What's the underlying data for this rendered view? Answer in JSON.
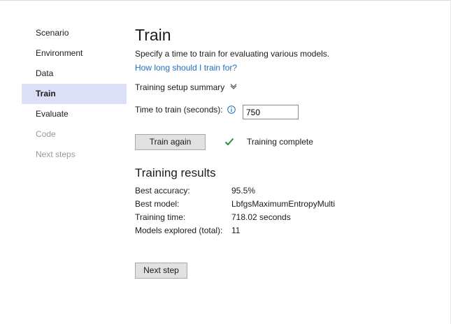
{
  "nav": [
    {
      "label": "Scenario",
      "state": "normal"
    },
    {
      "label": "Environment",
      "state": "normal"
    },
    {
      "label": "Data",
      "state": "normal"
    },
    {
      "label": "Train",
      "state": "selected"
    },
    {
      "label": "Evaluate",
      "state": "normal"
    },
    {
      "label": "Code",
      "state": "disabled"
    },
    {
      "label": "Next steps",
      "state": "disabled"
    }
  ],
  "main": {
    "title": "Train",
    "subtitle": "Specify a time to train for evaluating various models.",
    "help_link": "How long should I train for?",
    "summary_label": "Training setup summary",
    "time_label": "Time to train (seconds):",
    "time_value": "750",
    "train_button": "Train again",
    "status_text": "Training complete",
    "results_title": "Training results",
    "results": [
      {
        "label": "Best accuracy:",
        "value": "95.5%"
      },
      {
        "label": "Best model:",
        "value": "LbfgsMaximumEntropyMulti"
      },
      {
        "label": "Training time:",
        "value": "718.02 seconds"
      },
      {
        "label": "Models explored (total):",
        "value": "11"
      }
    ],
    "next_button": "Next step"
  },
  "colors": {
    "accent_link": "#1a6fc2",
    "selected_bg": "#dcdff5",
    "success_check": "#2e8b3e"
  },
  "icons": {
    "summary": "chevron-down-icon",
    "info": "info-icon",
    "status": "checkmark-icon"
  }
}
